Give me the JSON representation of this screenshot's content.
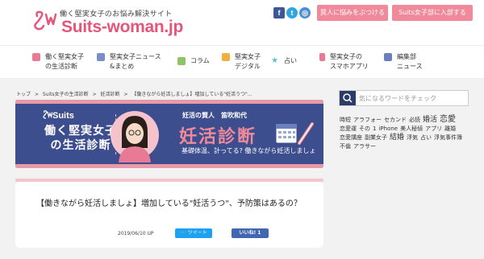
{
  "header": {
    "tagline": "働く堅実女子のお悩み解決サイト",
    "logo_suits": "Suits",
    "logo_dash": "-",
    "logo_woman": "woman",
    "logo_jp": ".jp",
    "social": {
      "facebook": "f",
      "twitter": "t",
      "instagram": "◎"
    },
    "btn_question": "質人に悩みをぶつける",
    "btn_join": "Suits女子部に入部する"
  },
  "nav": {
    "items": [
      {
        "label": "働く堅実女子\nの生活診断",
        "icon_color": "#e87a96",
        "icon": "pink-check-icon"
      },
      {
        "label": "堅実女子ニュース\n&まとめ",
        "icon_color": "#7b8dc6",
        "icon": "news-icon"
      },
      {
        "label": "コラム",
        "icon_color": "#8ec36a",
        "icon": "column-icon"
      },
      {
        "label": "堅実女子\nデジタル",
        "icon_color": "#f0b040",
        "icon": "digital-icon"
      },
      {
        "label": "占い",
        "icon_color": "#5bbfd0",
        "icon": "star-icon"
      },
      {
        "label": "堅実女子の\nスマホアプリ",
        "icon_color": "#e87a96",
        "icon": "app-icon"
      },
      {
        "label": "編集部\nニュース",
        "icon_color": "#6a7fc0",
        "icon": "pencil-icon"
      }
    ]
  },
  "breadcrumb": [
    "トップ",
    ">",
    "Suits女子の生活診断",
    ">",
    "妊活診断",
    ">",
    "【働きながら妊活しましょ】増加している\"妊活うつ\"..."
  ],
  "banner": {
    "logo": "Suits",
    "series": "働く堅実女子\nの生活診断",
    "name": "妊活の賢人　笛吹和代",
    "title": "妊活診断",
    "subtitle": "基礎体温、計ってる? 働きながら妊活しましょ"
  },
  "article": {
    "title": "【働きながら妊活しましょ】増加している\"妊活うつ\"、予防策はあるの？",
    "date": "2019/06/10 UP",
    "tweet": "ツイート",
    "like": "いいね! 1"
  },
  "sidebar": {
    "search_placeholder": "気になるワードをチェック",
    "tags": [
      "時短",
      "アラフォー",
      "セカンド",
      "必読",
      "婚活",
      "恋愛",
      "恋愛運",
      "その",
      "1",
      "iPhone",
      "美人秘偵",
      "アプリ",
      "離婚",
      "恋愛講座",
      "副業女子",
      "結婚",
      "浮気",
      "占い",
      "浮気事件簿",
      "不倫",
      "アラサー"
    ]
  }
}
